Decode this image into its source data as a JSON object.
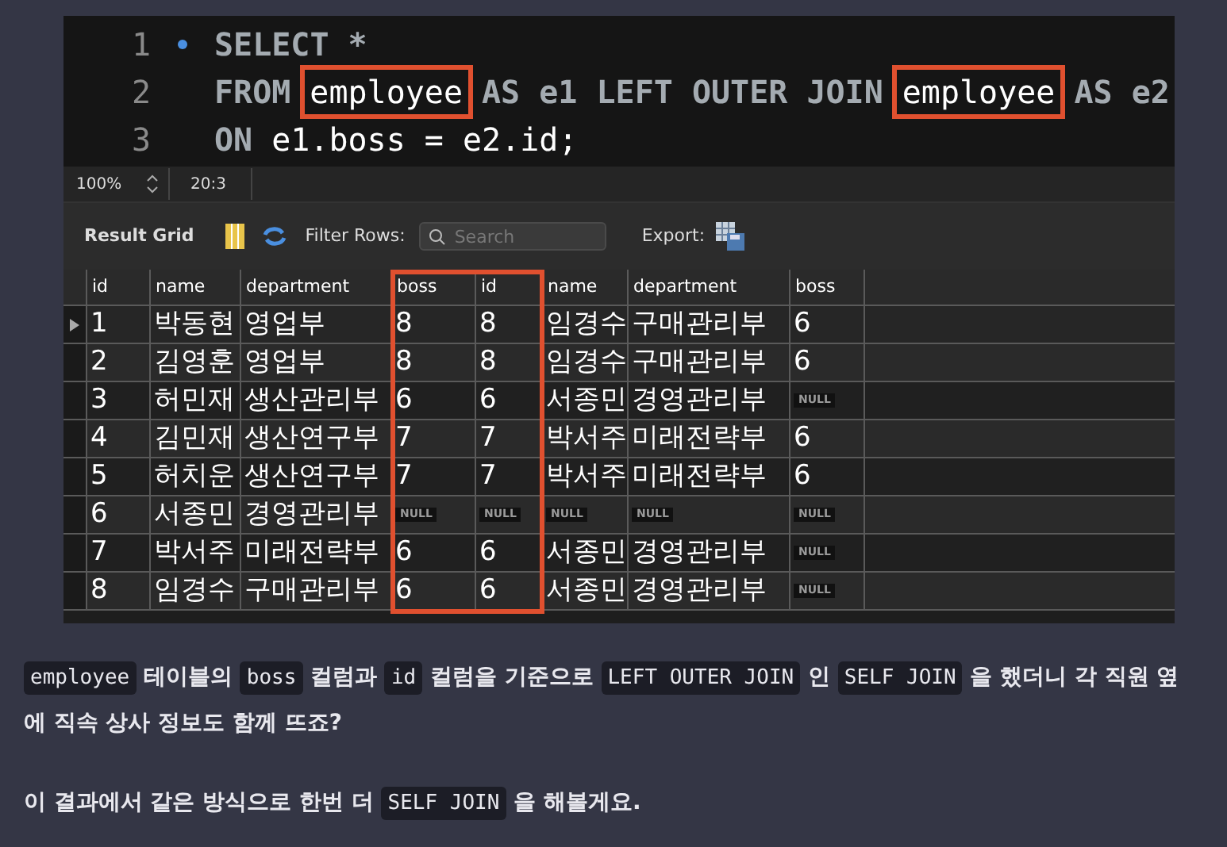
{
  "editor": {
    "lines": [
      {
        "number": "1",
        "marker": true,
        "tokens": [
          {
            "text": "SELECT *",
            "kind": "keyword",
            "highlighted": false
          }
        ]
      },
      {
        "number": "2",
        "marker": false,
        "tokens": [
          {
            "text": "FROM",
            "kind": "keyword",
            "highlighted": false
          },
          {
            "text": "employee",
            "kind": "name",
            "highlighted": true
          },
          {
            "text": "AS e1 LEFT OUTER JOIN",
            "kind": "keyword",
            "highlighted": false
          },
          {
            "text": "employee",
            "kind": "name",
            "highlighted": true
          },
          {
            "text": "AS e2",
            "kind": "keyword",
            "highlighted": false
          }
        ]
      },
      {
        "number": "3",
        "marker": false,
        "tokens": [
          {
            "text": "ON",
            "kind": "keyword",
            "highlighted": false
          },
          {
            "text": "e1.boss = e2.id;",
            "kind": "name",
            "highlighted": false
          }
        ]
      }
    ]
  },
  "status_bar": {
    "zoom": "100%",
    "position": "20:3"
  },
  "toolbar": {
    "title": "Result Grid",
    "filter_label": "Filter Rows:",
    "search": {
      "placeholder": "Search"
    },
    "export_label": "Export:"
  },
  "table": {
    "columns": [
      {
        "label": "id",
        "highlighted": false
      },
      {
        "label": "name",
        "highlighted": false
      },
      {
        "label": "department",
        "highlighted": false
      },
      {
        "label": "boss",
        "highlighted": true
      },
      {
        "label": "id",
        "highlighted": true
      },
      {
        "label": "name",
        "highlighted": false
      },
      {
        "label": "department",
        "highlighted": false
      },
      {
        "label": "boss",
        "highlighted": false
      }
    ],
    "rows": [
      {
        "selected": true,
        "cells": [
          "1",
          "박동현",
          "영업부",
          "8",
          "8",
          "임경수",
          "구매관리부",
          "6"
        ]
      },
      {
        "selected": false,
        "cells": [
          "2",
          "김영훈",
          "영업부",
          "8",
          "8",
          "임경수",
          "구매관리부",
          "6"
        ]
      },
      {
        "selected": false,
        "cells": [
          "3",
          "허민재",
          "생산관리부",
          "6",
          "6",
          "서종민",
          "경영관리부",
          {
            "text": "NULL",
            "kind": "null"
          }
        ]
      },
      {
        "selected": false,
        "cells": [
          "4",
          "김민재",
          "생산연구부",
          "7",
          "7",
          "박서주",
          "미래전략부",
          "6"
        ]
      },
      {
        "selected": false,
        "cells": [
          "5",
          "허치운",
          "생산연구부",
          "7",
          "7",
          "박서주",
          "미래전략부",
          "6"
        ]
      },
      {
        "selected": false,
        "cells": [
          "6",
          "서종민",
          "경영관리부",
          {
            "text": "NULL",
            "kind": "null"
          },
          {
            "text": "NULL",
            "kind": "null"
          },
          {
            "text": "NULL",
            "kind": "null"
          },
          {
            "text": "NULL",
            "kind": "null"
          },
          {
            "text": "NULL",
            "kind": "null"
          }
        ]
      },
      {
        "selected": false,
        "cells": [
          "7",
          "박서주",
          "미래전략부",
          "6",
          "6",
          "서종민",
          "경영관리부",
          {
            "text": "NULL",
            "kind": "null"
          }
        ]
      },
      {
        "selected": false,
        "cells": [
          "8",
          "임경수",
          "구매관리부",
          "6",
          "6",
          "서종민",
          "경영관리부",
          {
            "text": "NULL",
            "kind": "null"
          }
        ]
      }
    ]
  },
  "paragraphs": [
    [
      {
        "text": "employee",
        "code": true
      },
      {
        "text": " 테이블의 ",
        "code": false
      },
      {
        "text": "boss",
        "code": true
      },
      {
        "text": " 컬럼과 ",
        "code": false
      },
      {
        "text": "id",
        "code": true
      },
      {
        "text": " 컬럼을 기준으로 ",
        "code": false
      },
      {
        "text": "LEFT OUTER JOIN",
        "code": true
      },
      {
        "text": " 인 ",
        "code": false
      },
      {
        "text": "SELF JOIN",
        "code": true
      },
      {
        "text": " 을 했더니 각 직원 옆에 직속 상사 정보도 함께 뜨죠?",
        "code": false
      }
    ],
    [
      {
        "text": "이 결과에서 같은 방식으로 한번 더 ",
        "code": false
      },
      {
        "text": "SELF JOIN",
        "code": true
      },
      {
        "text": " 을 해볼게요.",
        "code": false
      }
    ]
  ]
}
